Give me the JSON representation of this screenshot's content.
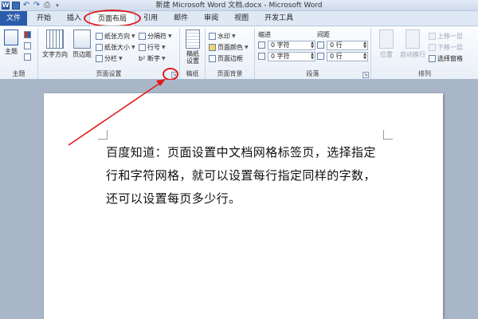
{
  "window": {
    "title": "新建 Microsoft Word 文档.docx - Microsoft Word"
  },
  "quick_access": {
    "icons": [
      "word-icon",
      "save-icon",
      "undo-icon",
      "redo-icon",
      "print-icon",
      "customize-icon"
    ]
  },
  "tabs": [
    {
      "label": "文件"
    },
    {
      "label": "开始"
    },
    {
      "label": "插入"
    },
    {
      "label": "页面布局"
    },
    {
      "label": "引用"
    },
    {
      "label": "邮件"
    },
    {
      "label": "审阅"
    },
    {
      "label": "视图"
    },
    {
      "label": "开发工具"
    }
  ],
  "ribbon": {
    "theme_group": {
      "label": "主题",
      "theme_button": "主题"
    },
    "page_setup_group": {
      "label": "页面设置",
      "text_direction": "文字方向",
      "margins": "页边距",
      "orientation": "纸张方向",
      "size": "纸张大小",
      "columns": "分栏",
      "breaks": "分隔符",
      "line_numbers": "行号",
      "hyphenation": "断字"
    },
    "manuscript_group": {
      "label": "稿纸",
      "manuscript_settings": "稿纸\n设置"
    },
    "page_background_group": {
      "label": "页面背景",
      "watermark": "水印",
      "page_color": "页面颜色",
      "page_borders": "页面边框"
    },
    "paragraph_group": {
      "label": "段落",
      "indent_label": "缩进",
      "spacing_label": "间距",
      "indent_left": "0 字符",
      "indent_right": "0 字符",
      "spacing_before": "0 行",
      "spacing_after": "0 行"
    },
    "arrange_group": {
      "label": "排列",
      "position": "位置",
      "wrap_text": "自动换行",
      "bring_forward": "上移一层",
      "send_backward": "下移一层",
      "selection_pane": "选择窗格"
    }
  },
  "document": {
    "body_text": "百度知道：页面设置中文档网格标签页，选择指定行和字符网格，就可以设置每行指定同样的字数，还可以设置每页多少行。"
  },
  "colors": {
    "file_tab": "#2a5caa",
    "annotation_red": "#e21a1a",
    "workspace": "#a9b6c8"
  }
}
